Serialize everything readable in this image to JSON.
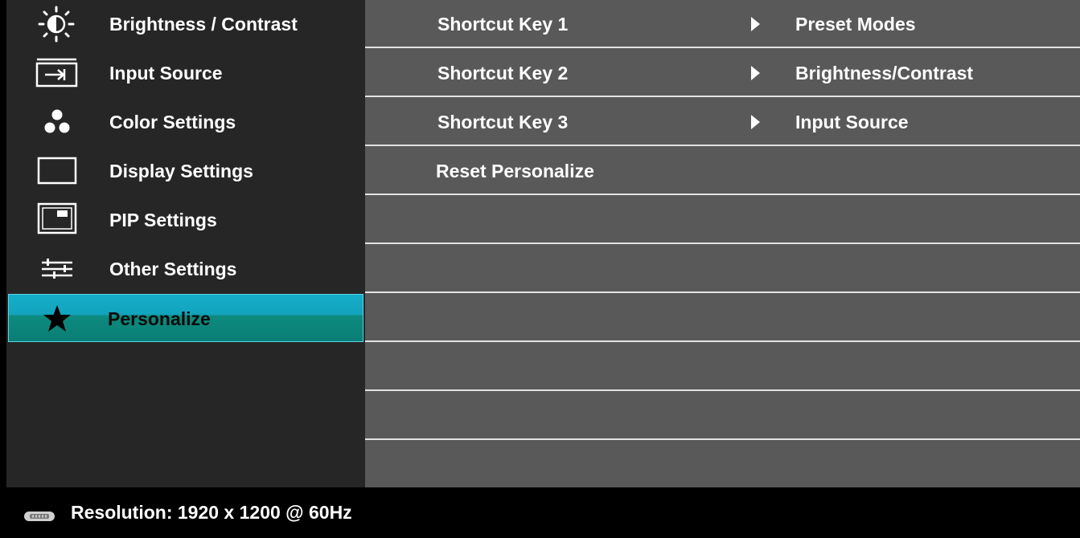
{
  "menu": {
    "items": [
      {
        "label": "Brightness / Contrast",
        "icon": "brightness-icon",
        "selected": false
      },
      {
        "label": "Input Source",
        "icon": "input-source-icon",
        "selected": false
      },
      {
        "label": "Color Settings",
        "icon": "color-dots-icon",
        "selected": false
      },
      {
        "label": "Display Settings",
        "icon": "display-rect-icon",
        "selected": false
      },
      {
        "label": "PIP Settings",
        "icon": "pip-icon",
        "selected": false
      },
      {
        "label": "Other Settings",
        "icon": "sliders-icon",
        "selected": false
      },
      {
        "label": "Personalize",
        "icon": "star-icon",
        "selected": true
      }
    ]
  },
  "panel": {
    "rows": [
      {
        "label": "Shortcut Key 1",
        "value": "Preset Modes"
      },
      {
        "label": "Shortcut Key 2",
        "value": "Brightness/Contrast"
      },
      {
        "label": "Shortcut Key 3",
        "value": "Input Source"
      },
      {
        "label": "Reset Personalize",
        "value": ""
      }
    ]
  },
  "status": {
    "text": "Resolution: 1920 x 1200 @ 60Hz",
    "icon": "connector-icon"
  },
  "colors": {
    "menu_bg": "#262626",
    "panel_bg": "#595959",
    "selected_top": "#14aec9",
    "selected_bottom": "#0a7e75",
    "divider": "#e3e3e3"
  }
}
